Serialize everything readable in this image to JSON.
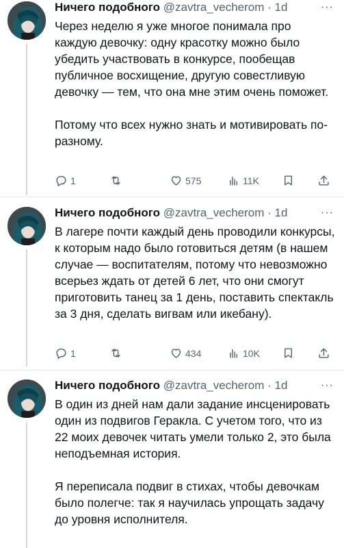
{
  "tweets": [
    {
      "author_name": "Ничего подобного",
      "handle": "@zavtra_vecherom",
      "separator": "·",
      "time": "1d",
      "more": "···",
      "paragraphs": [
        "Через неделю я уже многое понимала про каждую девочку: одну красотку можно было убедить участвовать в конкурсе, пообещав публичное восхищение, другую совестливую девочку — тем, что она мне этим очень поможет.",
        "Потому что всех нужно знать и мотивировать по-разному."
      ],
      "replies": "1",
      "retweets": "",
      "likes": "575",
      "views": "11K"
    },
    {
      "author_name": "Ничего подобного",
      "handle": "@zavtra_vecherom",
      "separator": "·",
      "time": "1d",
      "more": "···",
      "paragraphs": [
        "В лагере почти каждый день проводили конкурсы, к которым надо было готовиться детям (в нашем случае — воспитателям, потому что невозможно всерьез ждать от детей 6 лет, что они смогут приготовить танец за 1 день, поставить спектакль за 3 дня, сделать вигвам или икебану)."
      ],
      "replies": "1",
      "retweets": "",
      "likes": "434",
      "views": "10K"
    },
    {
      "author_name": "Ничего подобного",
      "handle": "@zavtra_vecherom",
      "separator": "·",
      "time": "1d",
      "more": "···",
      "paragraphs": [
        "В один из дней нам дали задание инсценировать один из подвигов Геракла. С учетом того, что из 22 моих девочек читать умели только 2, это была неподъемная история.",
        "Я переписала подвиг в стихах, чтобы девочкам было полегче: так я научилась упрощать задачу до уровня исполнителя."
      ]
    }
  ]
}
